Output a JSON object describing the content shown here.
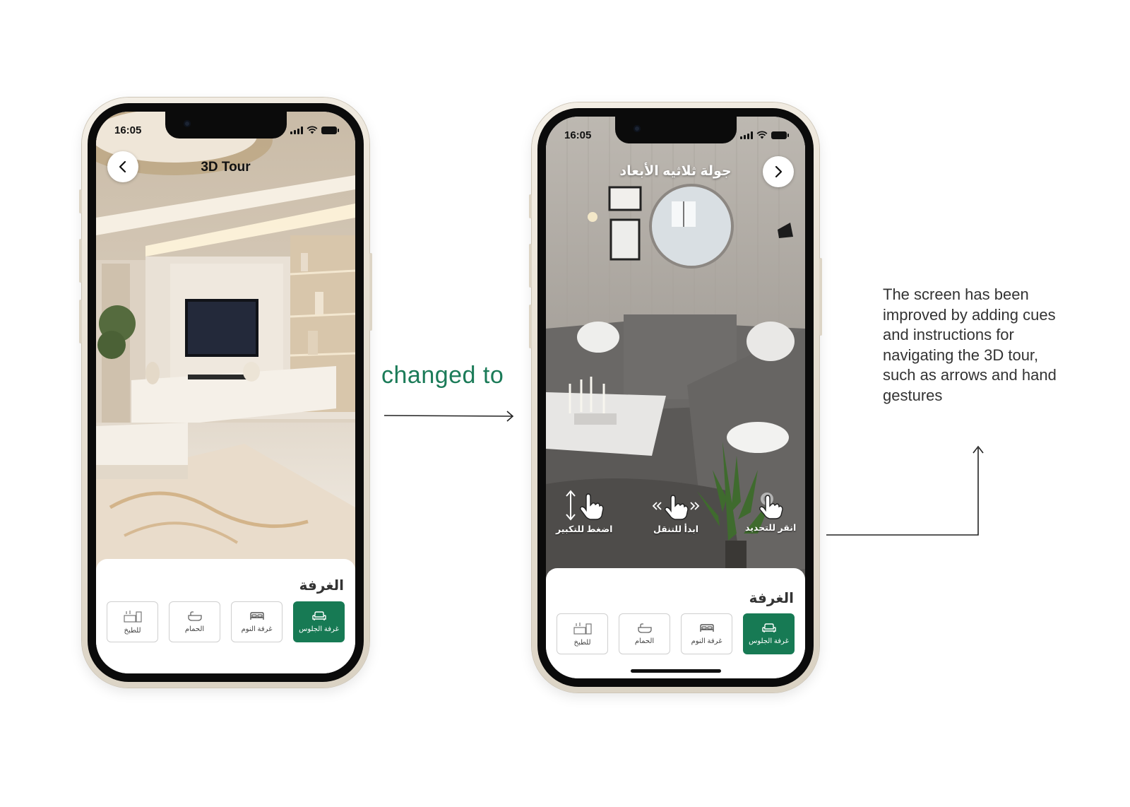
{
  "before_phone": {
    "status": {
      "time": "16:05"
    },
    "header": {
      "title": "3D Tour",
      "back_icon": "chevron-left-icon"
    },
    "room_panel": {
      "title": "الغرفة",
      "categories": [
        {
          "label": "للطبخ",
          "icon": "kitchen-icon",
          "active": false
        },
        {
          "label": "الحمام",
          "icon": "bathtub-icon",
          "active": false
        },
        {
          "label": "غرفة النوم",
          "icon": "bed-icon",
          "active": false
        },
        {
          "label": "غرفة الجلوس",
          "icon": "sofa-icon",
          "active": true
        }
      ]
    }
  },
  "after_phone": {
    "status": {
      "time": "16:05"
    },
    "header": {
      "title": "جولة ثلاثيه الأبعاد",
      "forward_icon": "chevron-right-icon"
    },
    "gestures": [
      {
        "label": "اضغط للتكبير",
        "icon": "pinch-zoom-hand-icon"
      },
      {
        "label": "ابدأ للتنقل",
        "icon": "swipe-hand-icon"
      },
      {
        "label": "انقر للتحديد",
        "icon": "tap-hand-icon"
      }
    ],
    "room_panel": {
      "title": "الغرفة",
      "categories": [
        {
          "label": "للطبخ",
          "icon": "kitchen-icon",
          "active": false
        },
        {
          "label": "الحمام",
          "icon": "bathtub-icon",
          "active": false
        },
        {
          "label": "غرفة النوم",
          "icon": "bed-icon",
          "active": false
        },
        {
          "label": "غرفة الجلوس",
          "icon": "sofa-icon",
          "active": true
        }
      ]
    }
  },
  "annotations": {
    "changed_label": "changed to",
    "note": "The screen has been improved by adding cues and instructions for navigating the 3D tour, such as arrows and hand gestures"
  },
  "colors": {
    "accent_green": "#177a54",
    "annotation_green": "#1b7b58",
    "note_text": "#333333"
  }
}
